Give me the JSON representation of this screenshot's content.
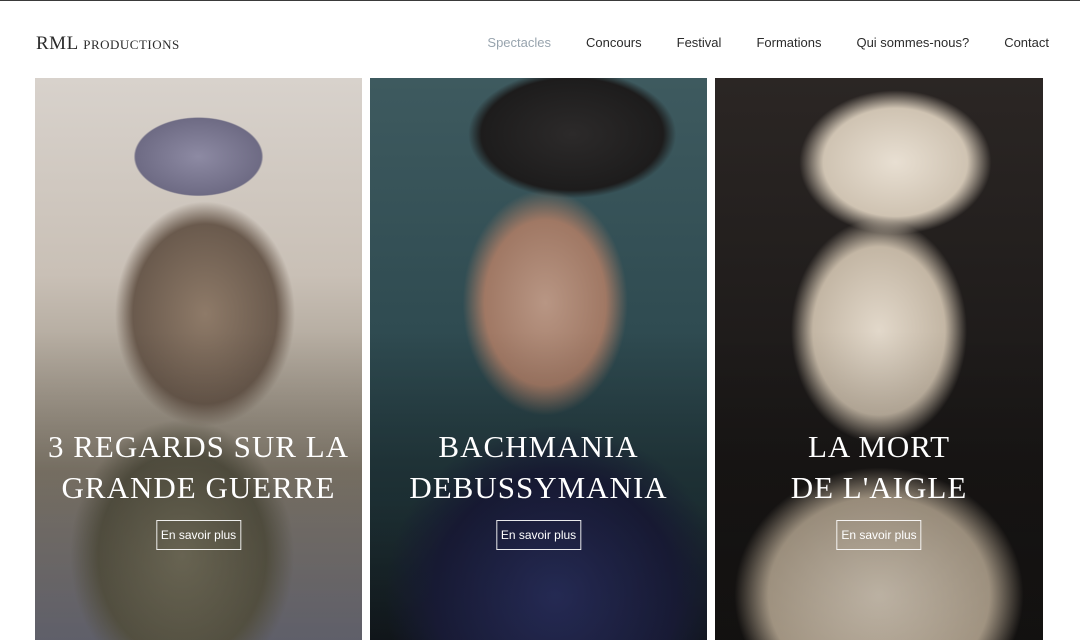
{
  "brand": "RML productions",
  "nav": [
    {
      "label": "Spectacles",
      "active": true
    },
    {
      "label": "Concours",
      "active": false
    },
    {
      "label": "Festival",
      "active": false
    },
    {
      "label": "Formations",
      "active": false
    },
    {
      "label": "Qui sommes-nous?",
      "active": false
    },
    {
      "label": "Contact",
      "active": false
    }
  ],
  "cards": [
    {
      "title": "3 REGARDS SUR LA\nGRANDE GUERRE",
      "button": "En savoir plus"
    },
    {
      "title": "BACHMANIA\nDEBUSSYMANIA",
      "button": "En savoir plus"
    },
    {
      "title": "LA MORT\nDE L'AIGLE",
      "button": "En savoir plus"
    }
  ],
  "colors": {
    "nav_active": "#98a4ae",
    "text": "#2b2b2b",
    "overlay_text": "#ffffff"
  }
}
